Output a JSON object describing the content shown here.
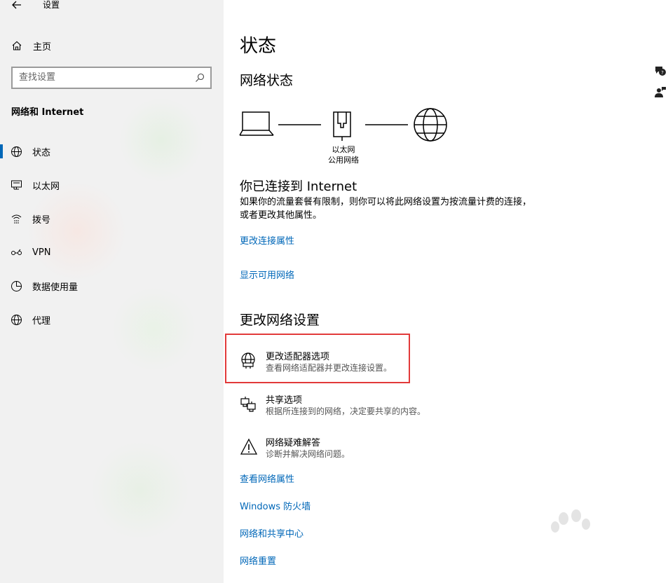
{
  "app": {
    "title": "设置"
  },
  "sidebar": {
    "home_label": "主页",
    "search_placeholder": "查找设置",
    "section_title": "网络和 Internet",
    "items": [
      {
        "label": "状态",
        "icon": "globe-icon",
        "selected": true
      },
      {
        "label": "以太网",
        "icon": "ethernet-icon",
        "selected": false
      },
      {
        "label": "拨号",
        "icon": "dialup-icon",
        "selected": false
      },
      {
        "label": "VPN",
        "icon": "vpn-icon",
        "selected": false
      },
      {
        "label": "数据使用量",
        "icon": "data-usage-icon",
        "selected": false
      },
      {
        "label": "代理",
        "icon": "globe-icon",
        "selected": false
      }
    ]
  },
  "main": {
    "title": "状态",
    "network_status_heading": "网络状态",
    "diagram": {
      "adapter_name": "以太网",
      "network_type": "公用网络"
    },
    "connected_heading": "你已连接到 Internet",
    "connected_body": "如果你的流量套餐有限制，则你可以将此网络设置为按流量计费的连接，或者更改其他属性。",
    "links_top": [
      "更改连接属性",
      "显示可用网络"
    ],
    "change_settings_heading": "更改网络设置",
    "options": [
      {
        "title": "更改适配器选项",
        "desc": "查看网络适配器并更改连接设置。",
        "icon": "adapter-globe-icon"
      },
      {
        "title": "共享选项",
        "desc": "根据所连接到的网络，决定要共享的内容。",
        "icon": "sharing-icon"
      },
      {
        "title": "网络疑难解答",
        "desc": "诊断并解决网络问题。",
        "icon": "warning-icon"
      }
    ],
    "links_bottom": [
      "查看网络属性",
      "Windows 防火墙",
      "网络和共享中心",
      "网络重置"
    ]
  },
  "colors": {
    "accent": "#0067b8",
    "highlight": "#e23a3a",
    "sidebar_bg": "#f1f1f1"
  }
}
